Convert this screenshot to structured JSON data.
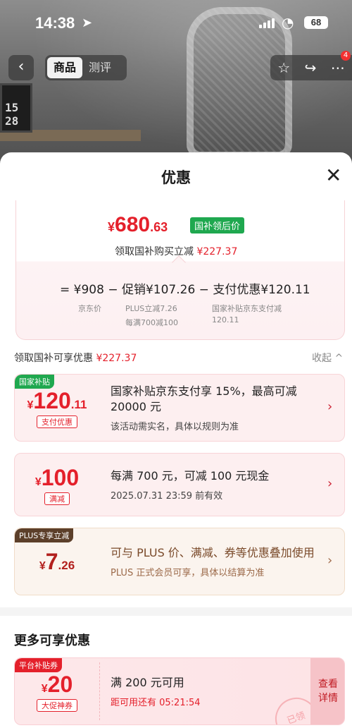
{
  "status_bar": {
    "time": "14:38",
    "battery": "68"
  },
  "product_nav": {
    "back": "‹",
    "tabs": [
      "商品",
      "测评"
    ],
    "cart_badge": "4"
  },
  "background": {
    "monitor_clock": "15 28"
  },
  "sheet": {
    "title": "优惠",
    "close": "✕"
  },
  "summary": {
    "price_symbol": "¥",
    "price_int": "680",
    "price_dec": ".63",
    "price_tag": "国补领后价",
    "desc_prefix": "领取国补购买立减",
    "desc_amount": "¥227.37",
    "formula": "= ¥908 − 促销¥107.26 − 支付优惠¥120.11",
    "jd_price_label": "京东价",
    "promo_detail_1": "PLUS立减7.26",
    "promo_detail_2": "每满700减100",
    "pay_detail_1": "国家补贴京东支付减",
    "pay_detail_2": "120.11"
  },
  "section": {
    "label": "领取国补可享优惠",
    "amount": "¥227.37",
    "collapse": "收起 ^"
  },
  "coupons": [
    {
      "corner": "国家补贴",
      "symbol": "¥",
      "int": "120",
      "dec": ".11",
      "pill": "支付优惠",
      "title": "国家补贴京东支付享 15%，最高可减 20000 元",
      "sub": "该活动需实名，具体以规则为准"
    },
    {
      "corner": "",
      "symbol": "¥",
      "int": "100",
      "dec": "",
      "pill": "满减",
      "title": "每满 700 元，可减 100 元现金",
      "sub": "2025.07.31 23:59 前有效"
    },
    {
      "corner": "PLUS专享立减",
      "symbol": "¥",
      "int": "7",
      "dec": ".26",
      "pill": "",
      "title": "可与 PLUS 价、满减、券等优惠叠加使用",
      "sub": "PLUS 正式会员可享，具体以结算为准"
    }
  ],
  "more": {
    "heading": "更多可享优惠",
    "coupon": {
      "corner": "平台补贴券",
      "symbol": "¥",
      "int": "20",
      "pill": "大促神券",
      "title": "满 200 元可用",
      "sub": "距可用还有 05:21:54",
      "view_line1": "查看",
      "view_line2": "详情",
      "stamp": "已领"
    }
  },
  "colors": {
    "accent": "#e4202b",
    "green_tag": "#1fa84f",
    "plus_brown": "#5c3f2a"
  }
}
